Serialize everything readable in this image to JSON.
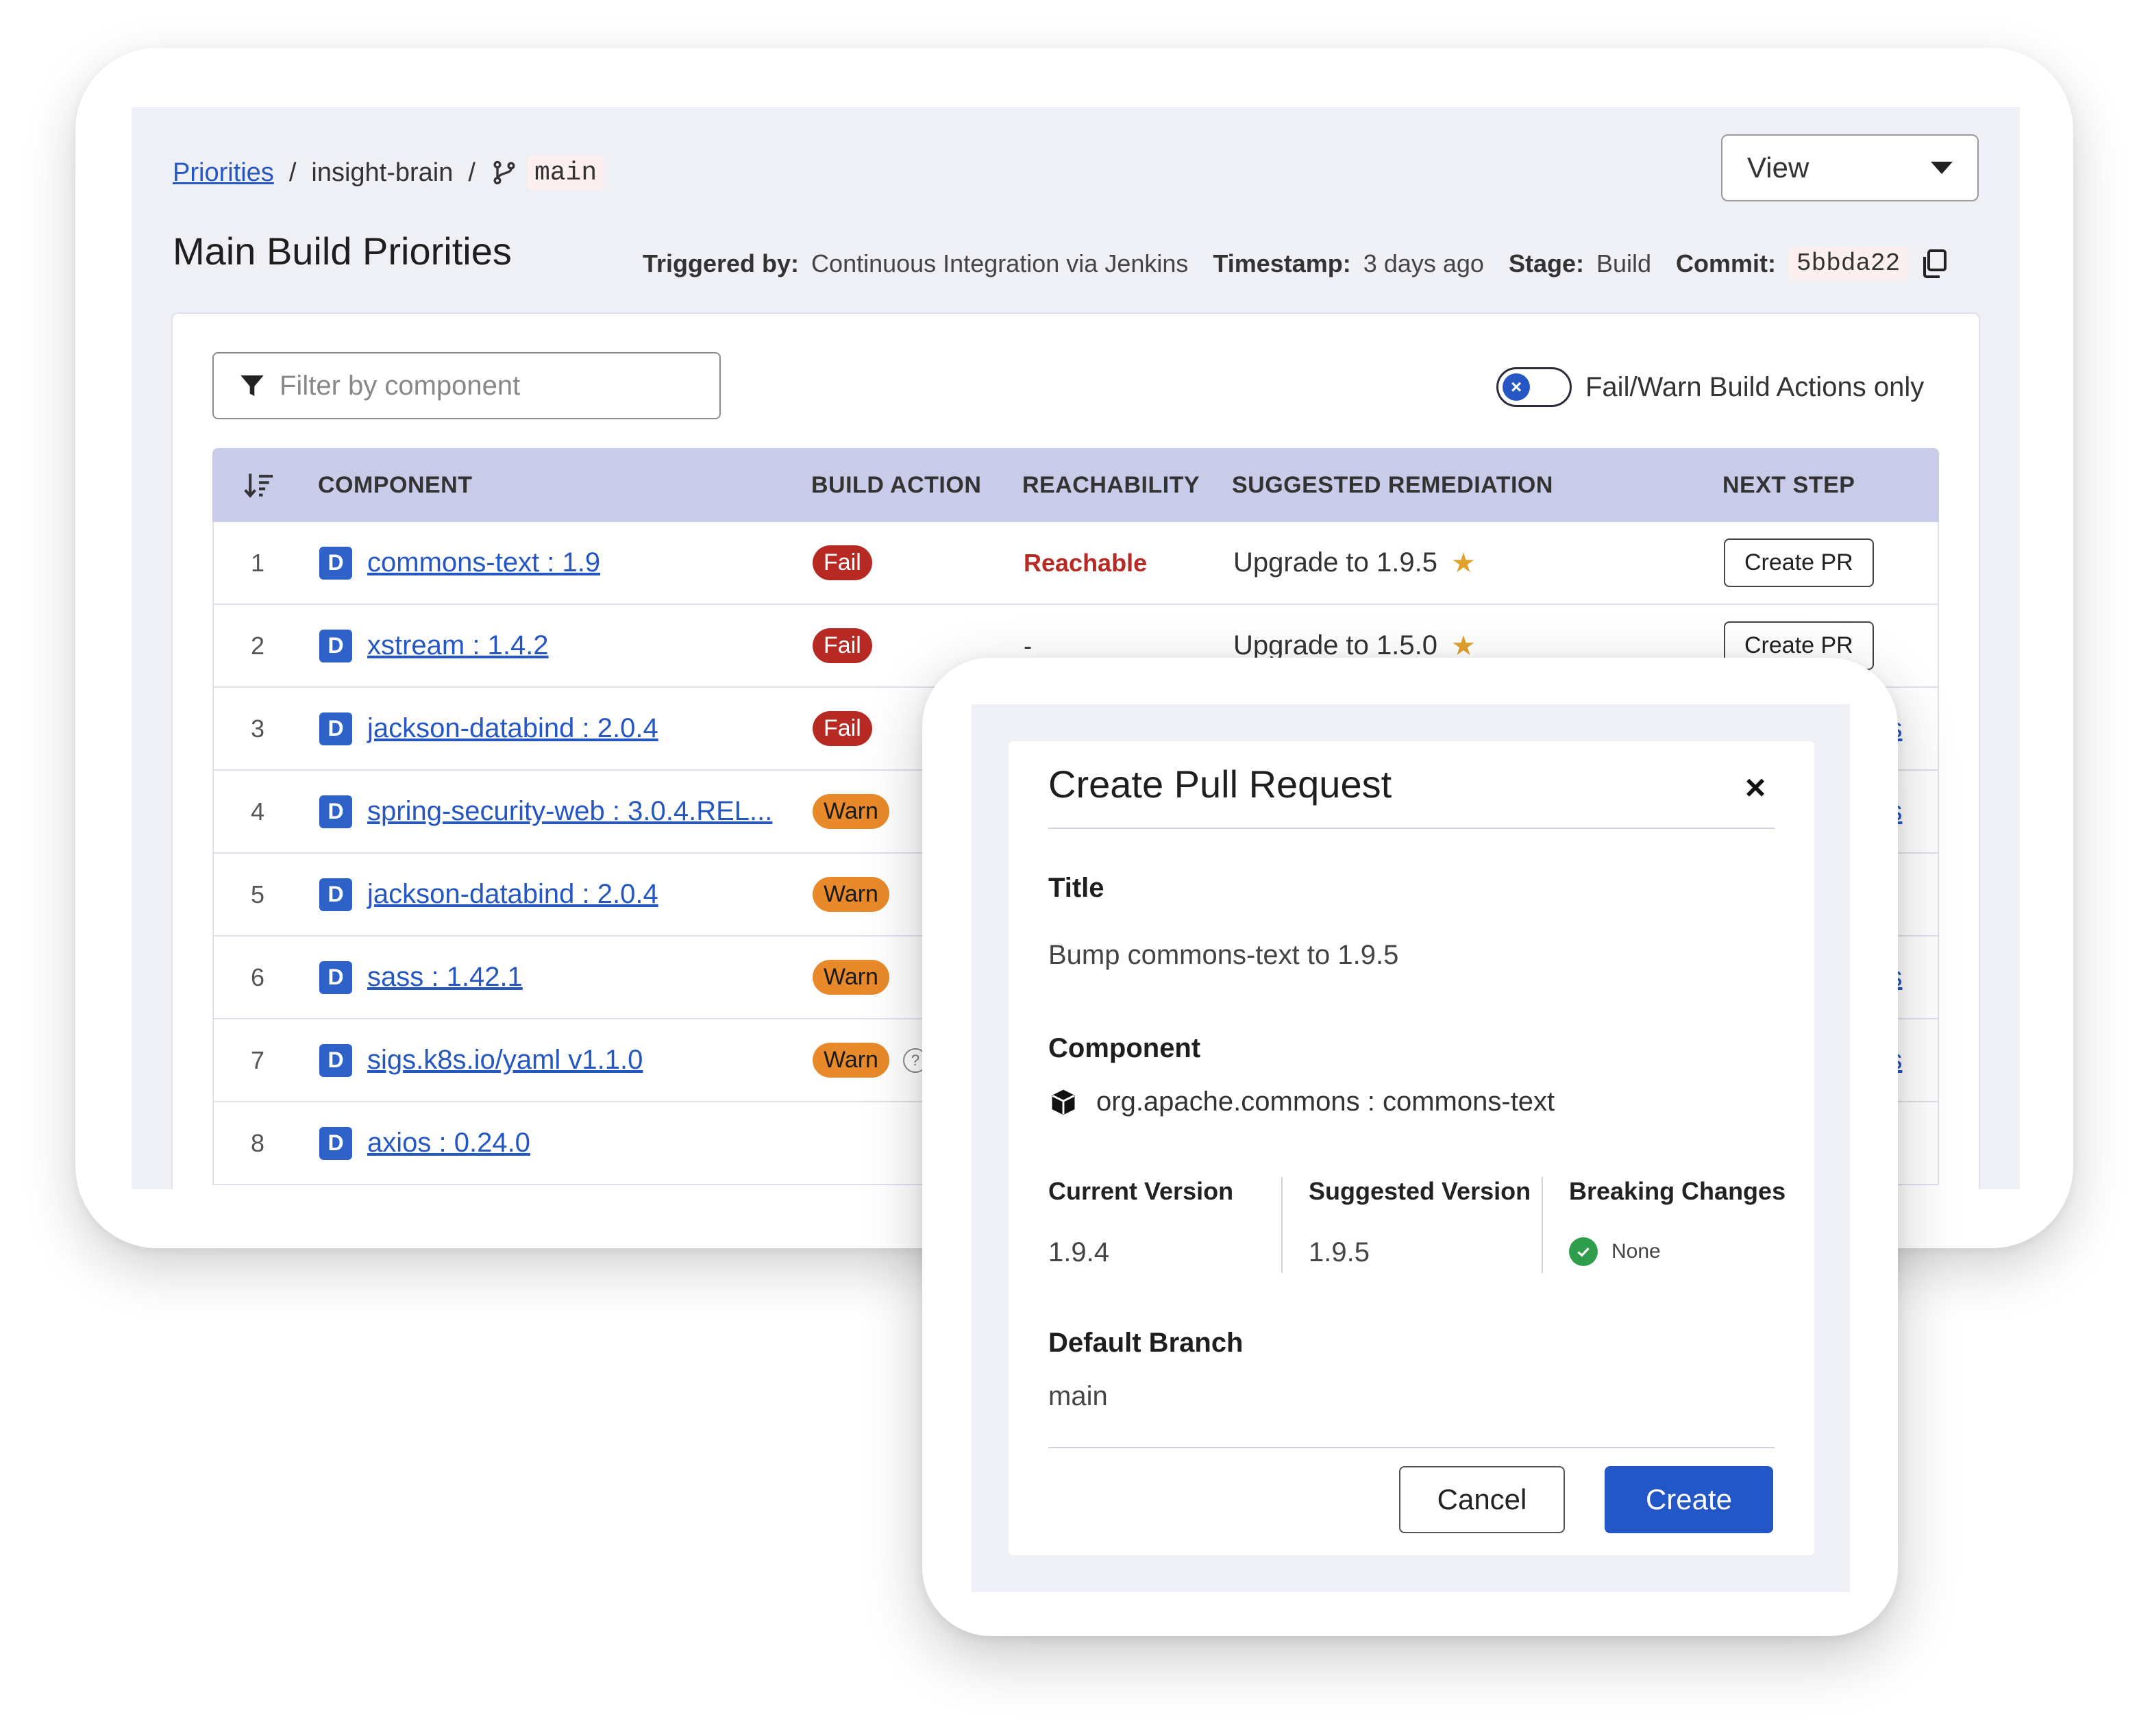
{
  "breadcrumb": {
    "root": "Priorities",
    "sep1": "/",
    "project": "insight-brain",
    "sep2": "/",
    "branch": "main"
  },
  "view_select": {
    "label": "View"
  },
  "page": {
    "title": "Main Build Priorities",
    "triggered_by_label": "Triggered by:",
    "triggered_by": "Continuous Integration via Jenkins",
    "timestamp_label": "Timestamp:",
    "timestamp": "3 days ago",
    "stage_label": "Stage:",
    "stage": "Build",
    "commit_label": "Commit:",
    "commit": "5bbda22"
  },
  "filter": {
    "placeholder": "Filter by component"
  },
  "toggle": {
    "label": "Fail/Warn Build Actions only",
    "knob": "×"
  },
  "table": {
    "columns": [
      "COMPONENT",
      "BUILD ACTION",
      "REACHABILITY",
      "SUGGESTED REMEDIATION",
      "NEXT STEP"
    ],
    "rows": [
      {
        "idx": "1",
        "badge": "D",
        "component": "commons-text : 1.9",
        "action": "Fail",
        "reach": "Reachable",
        "remediation": "Upgrade to 1.9.5",
        "star": "★",
        "next": "Create PR"
      },
      {
        "idx": "2",
        "badge": "D",
        "component": "xstream : 1.4.2",
        "action": "Fail",
        "reach": "-",
        "remediation": "Upgrade to 1.5.0",
        "star": "★",
        "next": "Create PR"
      },
      {
        "idx": "3",
        "badge": "D",
        "component": "jackson-databind : 2.0.4",
        "action": "Fail",
        "link": "tions"
      },
      {
        "idx": "4",
        "badge": "D",
        "component": "spring-security-web : 3.0.4.REL...",
        "action": "Warn",
        "link": "tions"
      },
      {
        "idx": "5",
        "badge": "D",
        "component": "jackson-databind : 2.0.4",
        "action": "Warn"
      },
      {
        "idx": "6",
        "badge": "D",
        "component": "sass : 1.42.1",
        "action": "Warn",
        "link": "tions"
      },
      {
        "idx": "7",
        "badge": "D",
        "component": "sigs.k8s.io/yaml v1.1.0",
        "action": "Warn",
        "help": "?",
        "link": "tions"
      },
      {
        "idx": "8",
        "badge": "D",
        "component": "axios : 0.24.0"
      }
    ]
  },
  "modal": {
    "title": "Create Pull Request",
    "close": "×",
    "title_label": "Title",
    "title_value": "Bump commons-text to 1.9.5",
    "component_label": "Component",
    "component_value": "org.apache.commons : commons-text",
    "current_version_label": "Current Version",
    "current_version": "1.9.4",
    "suggested_version_label": "Suggested Version",
    "suggested_version": "1.9.5",
    "breaking_changes_label": "Breaking Changes",
    "breaking_changes": "None",
    "default_branch_label": "Default Branch",
    "default_branch": "main",
    "cancel": "Cancel",
    "create": "Create"
  },
  "colors": {
    "accent": "#2356c6",
    "fail": "#b72a24",
    "warn": "#e98a2a",
    "header_bg": "#c8cce8"
  }
}
